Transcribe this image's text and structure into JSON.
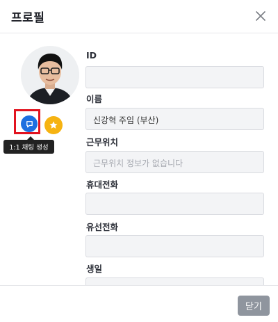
{
  "dialog": {
    "title": "프로필",
    "close_icon": "close-icon"
  },
  "profile": {
    "chat_icon": "chat-bubble-icon",
    "favorite_icon": "star-icon",
    "chat_tooltip": "1:1 채팅 생성"
  },
  "fields": {
    "id": {
      "label": "ID",
      "value": ""
    },
    "name": {
      "label": "이름",
      "value": "신강혁 주임 (부산)"
    },
    "location": {
      "label": "근무위치",
      "value": "",
      "placeholder": "근무위치 정보가 없습니다"
    },
    "mobile": {
      "label": "휴대전화",
      "value": ""
    },
    "phone": {
      "label": "유선전화",
      "value": ""
    },
    "birthday": {
      "label": "생일",
      "value": ""
    }
  },
  "footer": {
    "close_label": "닫기"
  },
  "colors": {
    "chat_button": "#1d6fe0",
    "favorite_button": "#f6b312",
    "highlight": "#e2131f",
    "close_button": "#8f959e"
  }
}
